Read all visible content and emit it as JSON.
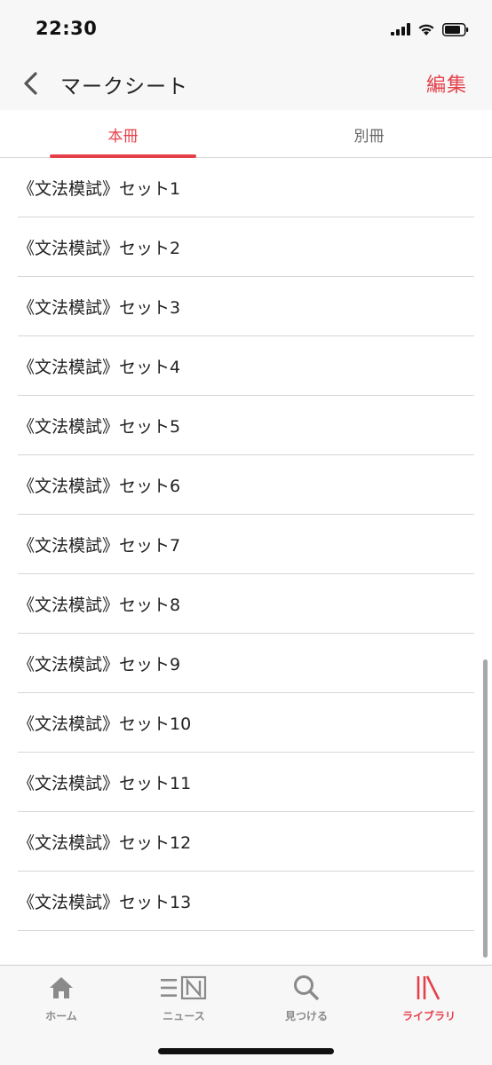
{
  "status_bar": {
    "time": "22:30"
  },
  "nav": {
    "title": "マークシート",
    "edit_label": "編集"
  },
  "tabs": [
    {
      "label": "本冊",
      "active": true
    },
    {
      "label": "別冊",
      "active": false
    }
  ],
  "list": {
    "items": [
      {
        "label": "《文法模試》セット1"
      },
      {
        "label": "《文法模試》セット2"
      },
      {
        "label": "《文法模試》セット3"
      },
      {
        "label": "《文法模試》セット4"
      },
      {
        "label": "《文法模試》セット5"
      },
      {
        "label": "《文法模試》セット6"
      },
      {
        "label": "《文法模試》セット7"
      },
      {
        "label": "《文法模試》セット8"
      },
      {
        "label": "《文法模試》セット9"
      },
      {
        "label": "《文法模試》セット10"
      },
      {
        "label": "《文法模試》セット11"
      },
      {
        "label": "《文法模試》セット12"
      },
      {
        "label": "《文法模試》セット13"
      }
    ]
  },
  "tab_bar": {
    "items": [
      {
        "label": "ホーム",
        "icon": "home-icon",
        "active": false
      },
      {
        "label": "ニュース",
        "icon": "news-icon",
        "active": false
      },
      {
        "label": "見つける",
        "icon": "search-icon",
        "active": false
      },
      {
        "label": "ライブラリ",
        "icon": "library-icon",
        "active": true
      }
    ]
  },
  "colors": {
    "accent": "#e5404a",
    "inactive": "#8a8a8a"
  }
}
